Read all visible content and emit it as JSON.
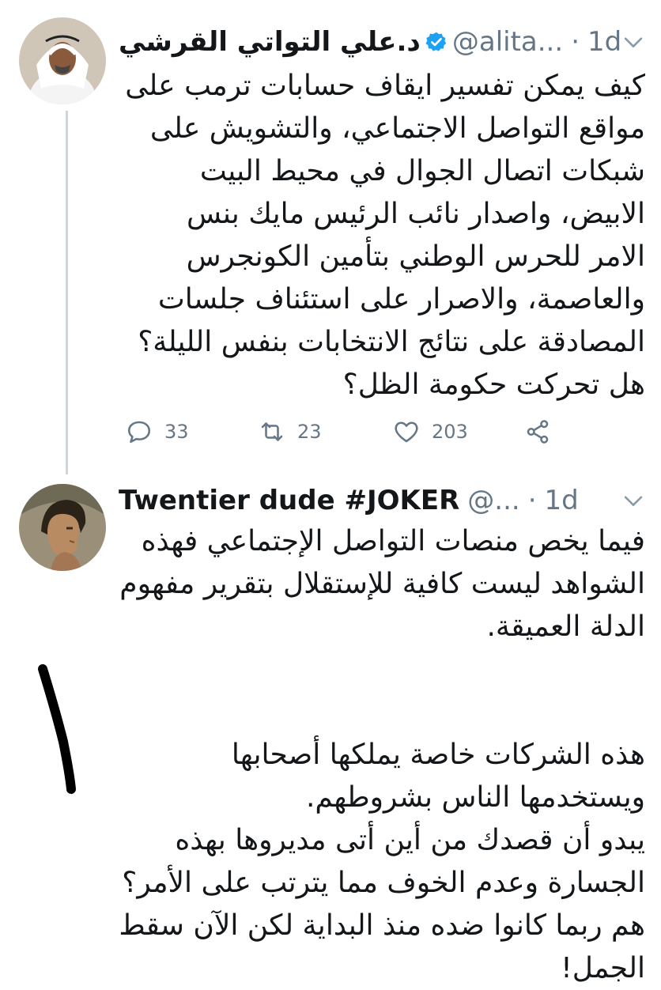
{
  "tweets": [
    {
      "display_name": "د.علي التواتي القرشي",
      "handle": "@alita...",
      "time": "1d",
      "dot": "·",
      "body": [
        "كيف يمكن تفسير ايقاف حسابات ترمب على",
        "مواقع التواصل الاجتماعي، والتشويش على",
        "شبكات اتصال الجوال في محيط البيت",
        "الابيض، واصدار نائب الرئيس مايك بنس",
        "الامر للحرس الوطني بتأمين الكونجرس",
        "والعاصمة، والاصرار على استئناف جلسات",
        "المصادقة على نتائج الانتخابات بنفس الليلة؟",
        "هل تحركت حكومة الظل؟"
      ],
      "actions": {
        "replies": "33",
        "retweets": "23",
        "likes": "203"
      }
    },
    {
      "display_name": "Twentier dude #JOKER",
      "handle": "@...",
      "time": "1d",
      "dot": "·",
      "body_p1": [
        "فيما يخص منصات التواصل الإجتماعي فهذه",
        "الشواهد ليست كافية للإستقلال بتقرير مفهوم",
        "الدلة العميقة."
      ],
      "body_p2": [
        "هذه الشركات خاصة يملكها أصحابها",
        "ويستخدمها الناس بشروطهم.",
        "يبدو أن قصدك من أين أتى مديروها بهذه",
        "الجسارة وعدم الخوف مما يترتب على الأمر؟",
        "هم ربما كانوا ضده منذ البداية لكن الآن سقط",
        "الجمل!"
      ]
    }
  ],
  "colors": {
    "verified": "#1da1f2",
    "muted": "#657786",
    "line": "#ccd6dd"
  },
  "icons": [
    "verified-icon",
    "chevron-down-icon",
    "reply-icon",
    "retweet-icon",
    "like-icon",
    "share-icon"
  ]
}
